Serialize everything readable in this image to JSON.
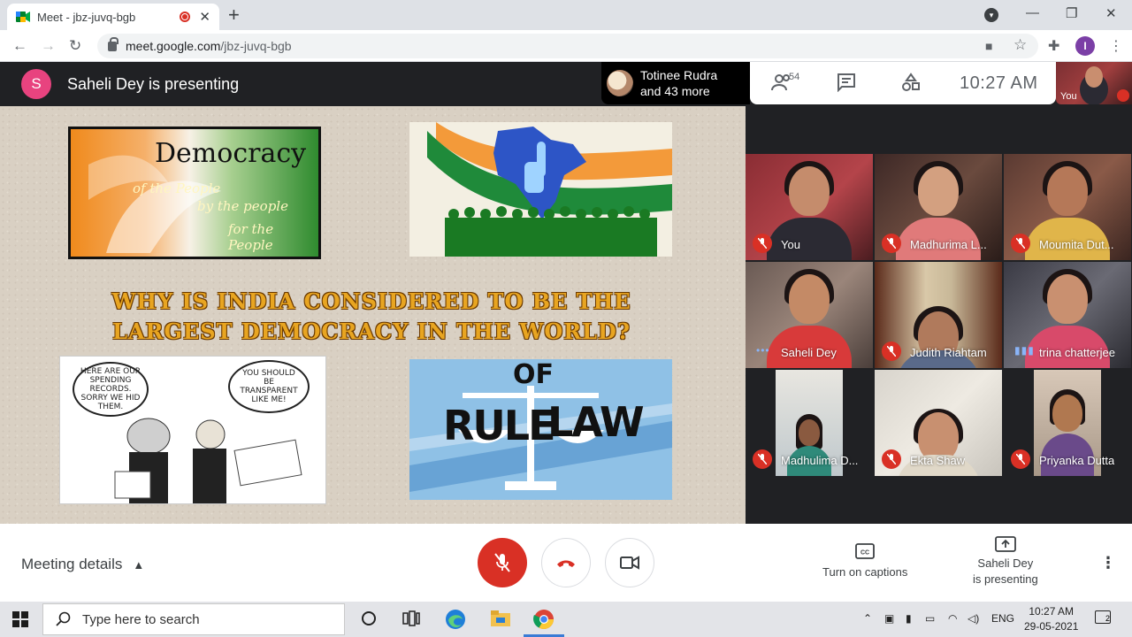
{
  "browser": {
    "tab_title": "Meet - jbz-juvq-bgb",
    "url_host": "meet.google.com",
    "url_path": "/jbz-juvq-bgb",
    "profile_initial": "I"
  },
  "meet": {
    "presenter_initial": "S",
    "presenting_label": "Saheli Dey is presenting",
    "attendee_name": "Totinee Rudra",
    "attendee_more": "and 43 more",
    "participant_count": "54",
    "clock": "10:27  AM",
    "self_label": "You"
  },
  "slide": {
    "democracy_title": "Democracy",
    "democracy_line1": "of the People",
    "democracy_line2": "by the people",
    "democracy_line3": "for the People",
    "headline": "WHY IS INDIA CONSIDERED TO BE THE LARGEST DEMOCRACY IN THE WORLD?",
    "cartoon_bubble1": "HERE ARE OUR SPENDING RECORDS. SORRY WE HID THEM.",
    "cartoon_bubble2": "YOU SHOULD BE TRANSPARENT LIKE ME!",
    "law_of": "OF",
    "law_rule": "RULE",
    "law_law": "LAW"
  },
  "participants": [
    {
      "name": "You",
      "state": "muted"
    },
    {
      "name": "Madhurima L...",
      "state": "muted"
    },
    {
      "name": "Moumita Dut...",
      "state": "muted"
    },
    {
      "name": "Saheli Dey",
      "state": "idle"
    },
    {
      "name": "Judith Riahtam",
      "state": "muted"
    },
    {
      "name": "trina chatterjee",
      "state": "speaking"
    },
    {
      "name": "Madhulima D...",
      "state": "muted"
    },
    {
      "name": "Ekta Shaw",
      "state": "muted"
    },
    {
      "name": "Priyanka Dutta",
      "state": "muted"
    }
  ],
  "bottom": {
    "meeting_details": "Meeting details",
    "captions": "Turn on captions",
    "presenting_line1": "Saheli Dey",
    "presenting_line2": "is presenting"
  },
  "taskbar": {
    "search_placeholder": "Type here to search",
    "lang": "ENG",
    "time": "10:27 AM",
    "date": "29-05-2021",
    "notifications": "2"
  },
  "colors": {
    "mic_off": "#d93025",
    "presenter_avatar": "#e8437f",
    "meet_dark": "#202124"
  }
}
